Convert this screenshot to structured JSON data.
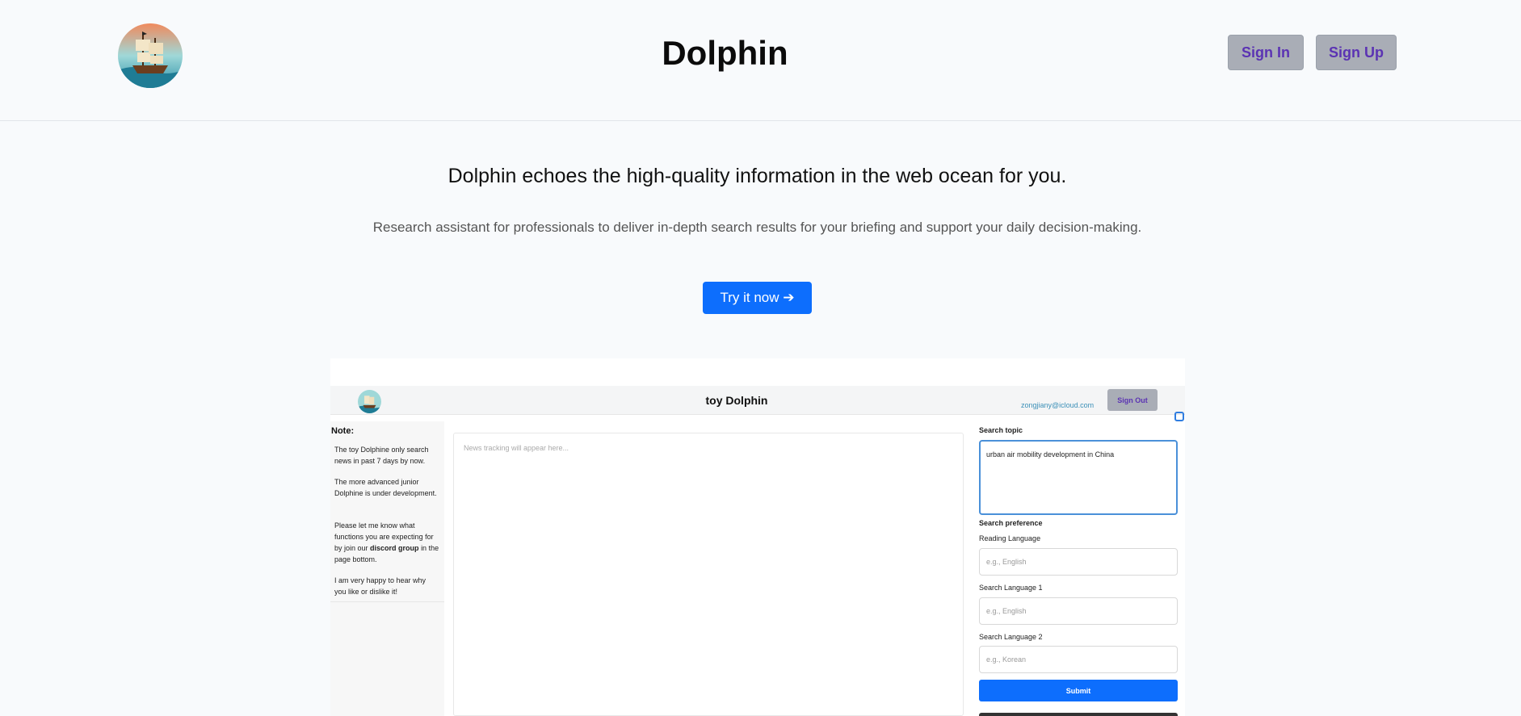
{
  "header": {
    "title": "Dolphin",
    "sign_in": "Sign In",
    "sign_up": "Sign Up",
    "logo_icon": "ship-logo-icon"
  },
  "hero": {
    "headline": "Dolphin echoes the high-quality information in the web ocean for you.",
    "subtitle": "Research assistant for professionals to deliver in-depth search results for your briefing and support your daily decision-making.",
    "cta": "Try it now ➔"
  },
  "preview": {
    "title": "toy Dolphin",
    "email": "zongjiany@icloud.com",
    "sign_out": "Sign Out",
    "note_title": "Note:",
    "notes": [
      "The toy Dolphine only search news in past 7 days by now.",
      "The more advanced junior Dolphine is under development.",
      "I am very happy to hear why you like or dislike it!"
    ],
    "note_feedback": {
      "before": "Please let me know what functions you are expecting for by join our",
      "link": "discord group",
      "after": "in the page bottom."
    },
    "news_placeholder": "News tracking will appear here...",
    "search_topic_label": "Search topic",
    "search_topic_value": "urban air mobility development in China",
    "search_preference_label": "Search preference",
    "reading_language_label": "Reading Language",
    "reading_language_placeholder": "e.g., English",
    "search_language_1_label": "Search Language 1",
    "search_language_1_placeholder": "e.g., English",
    "search_language_2_label": "Search Language 2",
    "search_language_2_placeholder": "e.g., Korean",
    "submit": "Submit"
  },
  "colors": {
    "primary": "#0d6efd",
    "auth_button_bg": "#a9adb6",
    "auth_button_text": "#5b33b3",
    "page_bg": "#f8fafc"
  }
}
